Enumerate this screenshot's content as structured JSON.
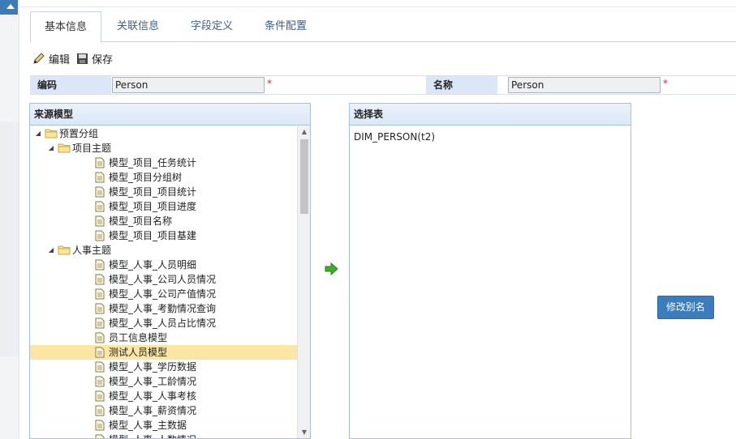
{
  "tabs": [
    {
      "label": "基本信息",
      "active": true
    },
    {
      "label": "关联信息"
    },
    {
      "label": "字段定义"
    },
    {
      "label": "条件配置"
    }
  ],
  "toolbar": {
    "edit_label": "编辑",
    "save_label": "保存"
  },
  "form": {
    "code_label": "编码",
    "code_value": "Person",
    "name_label": "名称",
    "name_value": "Person",
    "required_mark": "*"
  },
  "source_panel": {
    "title": "来源模型",
    "selected": "测试人员模型",
    "tree": [
      {
        "label": "预置分组",
        "type": "folder",
        "level": 0,
        "expanded": true
      },
      {
        "label": "项目主题",
        "type": "folder",
        "level": 1,
        "expanded": true
      },
      {
        "label": "模型_项目_任务统计",
        "type": "file",
        "level": 2
      },
      {
        "label": "模型_项目分组树",
        "type": "file",
        "level": 2
      },
      {
        "label": "模型_项目_项目统计",
        "type": "file",
        "level": 2
      },
      {
        "label": "模型_项目_项目进度",
        "type": "file",
        "level": 2
      },
      {
        "label": "模型_项目名称",
        "type": "file",
        "level": 2
      },
      {
        "label": "模型_项目_项目基建",
        "type": "file",
        "level": 2
      },
      {
        "label": "人事主题",
        "type": "folder",
        "level": 1,
        "expanded": true
      },
      {
        "label": "模型_人事_人员明细",
        "type": "file",
        "level": 2
      },
      {
        "label": "模型_人事_公司人员情况",
        "type": "file",
        "level": 2
      },
      {
        "label": "模型_人事_公司产值情况",
        "type": "file",
        "level": 2
      },
      {
        "label": "模型_人事_考勤情况查询",
        "type": "file",
        "level": 2
      },
      {
        "label": "模型_人事_人员占比情况",
        "type": "file",
        "level": 2
      },
      {
        "label": "员工信息模型",
        "type": "file",
        "level": 2
      },
      {
        "label": "测试人员模型",
        "type": "file",
        "level": 2
      },
      {
        "label": "模型_人事_学历数据",
        "type": "file",
        "level": 2
      },
      {
        "label": "模型_人事_工龄情况",
        "type": "file",
        "level": 2
      },
      {
        "label": "模型_人事_人事考核",
        "type": "file",
        "level": 2
      },
      {
        "label": "模型_人事_薪资情况",
        "type": "file",
        "level": 2
      },
      {
        "label": "模型_人事_主数据",
        "type": "file",
        "level": 2
      },
      {
        "label": "模型_人事_人数情况",
        "type": "file",
        "level": 2
      }
    ]
  },
  "target_panel": {
    "title": "选择表",
    "items": [
      "DIM_PERSON(t2)"
    ]
  },
  "rename_button": "修改别名",
  "colors": {
    "accent": "#3a7cbd",
    "header_bg": "#dbe7f8",
    "selected_row": "#fbe6a4",
    "arrow_green": "#3fae2a"
  }
}
